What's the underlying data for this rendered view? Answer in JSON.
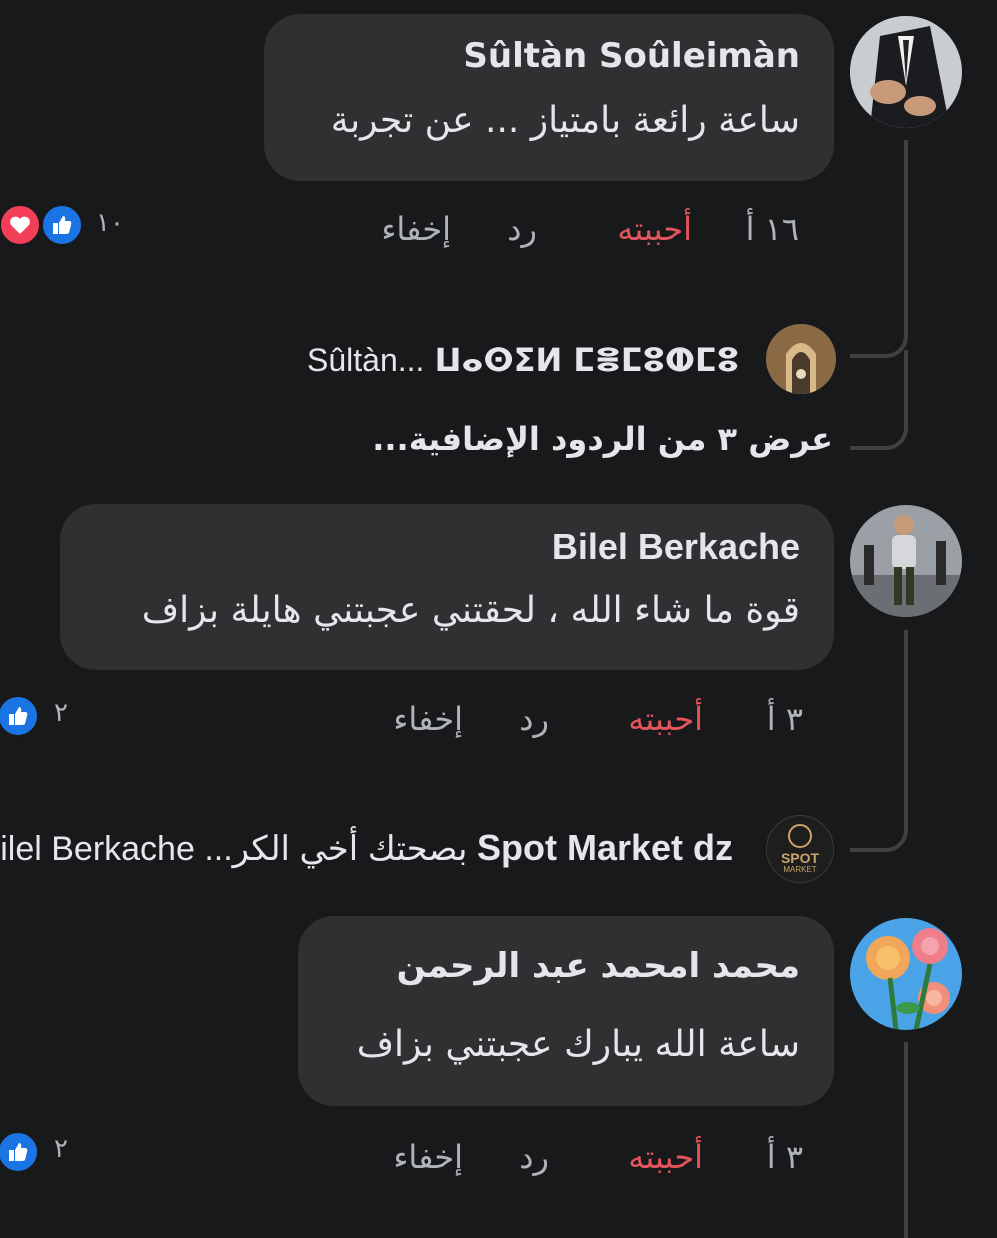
{
  "comments": [
    {
      "author": "Sûltàn Soûleimàn",
      "text": "ساعة رائعة بامتياز ... عن تجربة",
      "time": "١٦ أ",
      "like_label": "أحببته",
      "reply_label": "رد",
      "hide_label": "إخفاء",
      "reaction_count": "١٠",
      "reactions": [
        "like-icon",
        "love-icon"
      ]
    },
    {
      "author": "Bilel Berkache",
      "text": "قوة ما شاء الله ، لحقتني عجبتني هايلة بزاف",
      "time": "٣ أ",
      "like_label": "أحببته",
      "reply_label": "رد",
      "hide_label": "إخفاء",
      "reaction_count": "٢",
      "reactions": [
        "like-icon"
      ]
    },
    {
      "author": "محمد امحمد عبد الرحمن",
      "text": "ساعة الله يبارك عجبتني بزاف",
      "time": "٣ أ",
      "like_label": "أحببته",
      "reply_label": "رد",
      "hide_label": "إخفاء",
      "reaction_count": "٢",
      "reactions": [
        "like-icon"
      ]
    }
  ],
  "replies": {
    "reply1": {
      "author": "ⵡⴰⵙⵉⵍ ⵎⴻⵎⵓⵀⵎⵓ",
      "preview": "Sûltàn..."
    },
    "more_replies": "عرض ٣ من الردود الإضافية...",
    "reply2": {
      "author": "Spot Market dz",
      "preview": "بصحتك أخي الكر... Bilel Berkache",
      "avatar_text": "SPOT",
      "avatar_sub": "MARKET"
    }
  },
  "colors": {
    "background": "#18191a",
    "bubble": "#2f3031",
    "like_active": "#e4555b",
    "like_blue": "#1b74e4",
    "love_red": "#f33e58"
  }
}
